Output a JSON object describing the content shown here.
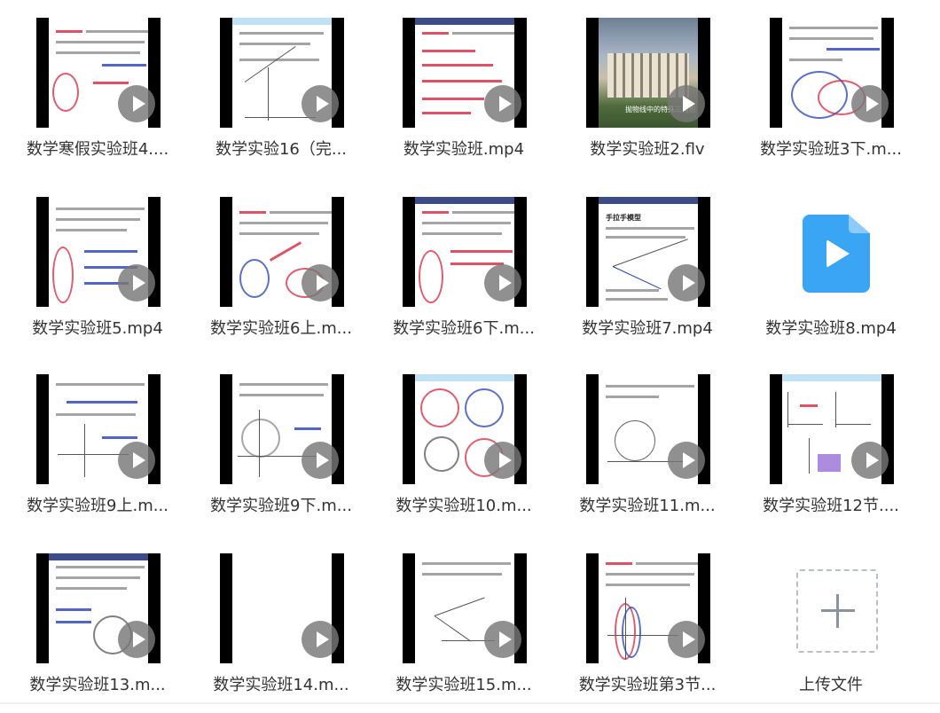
{
  "files": [
    {
      "name": "数学寒假实验班4...."
    },
    {
      "name": "数学实验16（完..."
    },
    {
      "name": "数学实验班.mp4"
    },
    {
      "name": "数学实验班2.flv",
      "caption": "抛物线中的特殊三角形"
    },
    {
      "name": "数学实验班3下.m..."
    },
    {
      "name": "数学实验班5.mp4"
    },
    {
      "name": "数学实验班6上.m..."
    },
    {
      "name": "数学实验班6下.m..."
    },
    {
      "name": "数学实验班7.mp4",
      "screen_title": "手拉手模型"
    },
    {
      "name": "数学实验班8.mp4"
    },
    {
      "name": "数学实验班9上.m..."
    },
    {
      "name": "数学实验班9下.m..."
    },
    {
      "name": "数学实验班10.m..."
    },
    {
      "name": "数学实验班11.m..."
    },
    {
      "name": "数学实验班12节...."
    },
    {
      "name": "数学实验班13.m..."
    },
    {
      "name": "数学实验班14.m..."
    },
    {
      "name": "数学实验班15.m..."
    },
    {
      "name": "数学实验班第3节..."
    }
  ],
  "upload": {
    "label": "上传文件"
  },
  "icons": {
    "play": "play-icon",
    "video_file": "video-file-icon",
    "upload": "plus-icon"
  },
  "colors": {
    "file_icon": "#3aa5f5",
    "slide_header": "#3c4c86",
    "ink_red": "#d7263d",
    "ink_blue": "#2540b8"
  }
}
